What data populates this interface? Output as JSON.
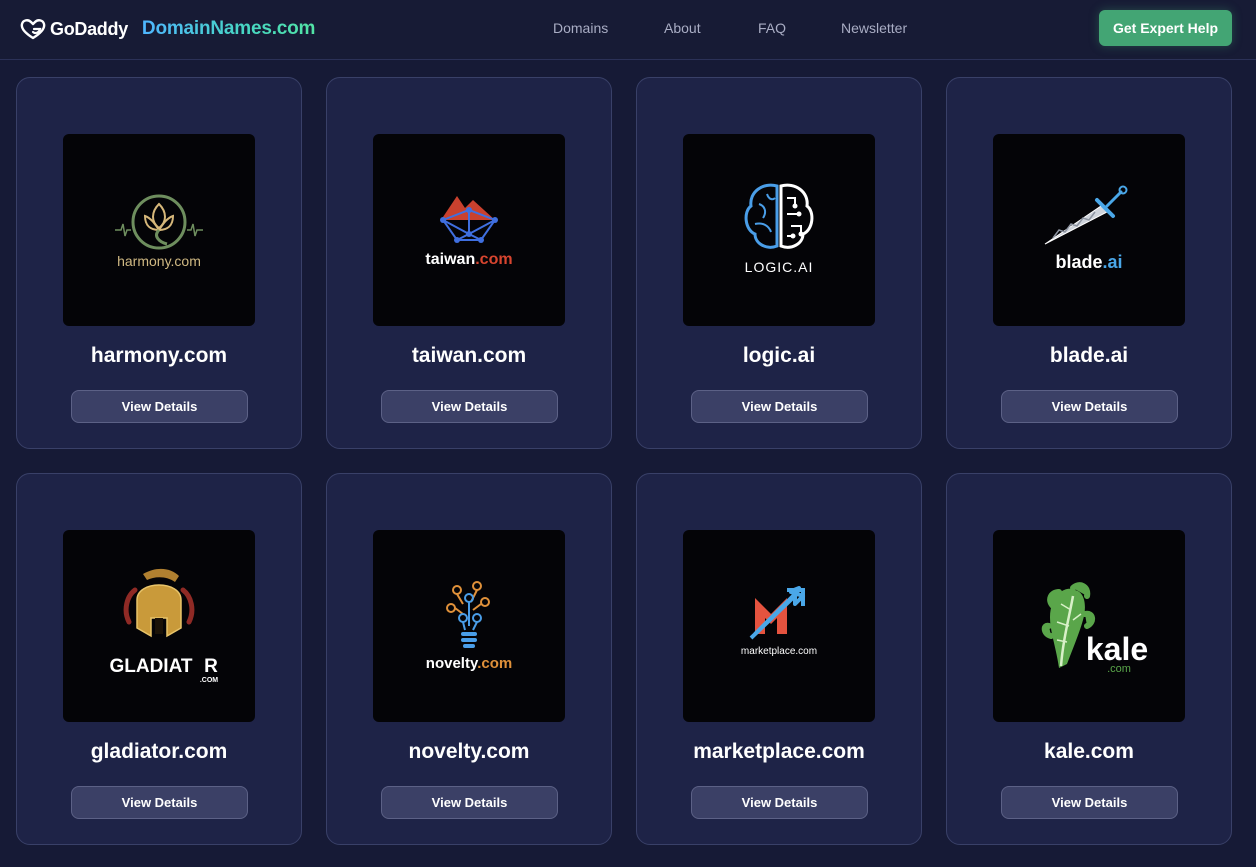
{
  "header": {
    "godaddy_label": "GoDaddy",
    "site_name": "DomainNames.com",
    "nav": [
      "Domains",
      "About",
      "FAQ",
      "Newsletter"
    ],
    "cta_label": "Get Expert Help"
  },
  "cards": [
    {
      "name": "harmony.com",
      "button": "View Details",
      "logo_text": "harmony.com",
      "logo_icon": "lotus-icon"
    },
    {
      "name": "taiwan.com",
      "button": "View Details",
      "logo_text_a": "taiwan",
      "logo_text_b": ".com",
      "logo_icon": "mountain-network-icon"
    },
    {
      "name": "logic.ai",
      "button": "View Details",
      "logo_text": "LOGIC.AI",
      "logo_icon": "brain-icon"
    },
    {
      "name": "blade.ai",
      "button": "View Details",
      "logo_text_a": "blade",
      "logo_text_b": ".ai",
      "logo_icon": "sword-icon"
    },
    {
      "name": "gladiator.com",
      "button": "View Details",
      "logo_text_a": "GLADIAT",
      "logo_text_b": "R",
      "logo_text_c": ".COM",
      "logo_icon": "helmet-icon"
    },
    {
      "name": "novelty.com",
      "button": "View Details",
      "logo_text_a": "novelty",
      "logo_text_b": ".com",
      "logo_icon": "lightbulb-icon"
    },
    {
      "name": "marketplace.com",
      "button": "View Details",
      "logo_text": "marketplace.com",
      "logo_icon": "m-arrow-icon"
    },
    {
      "name": "kale.com",
      "button": "View Details",
      "logo_text_a": "kale",
      "logo_text_b": ".com",
      "logo_icon": "kale-leaf-icon"
    }
  ],
  "colors": {
    "background": "#161a36",
    "card": "#1e2347",
    "cta": "#43a574",
    "brand_gradient_start": "#4fb6ff",
    "brand_gradient_end": "#52e3a5"
  }
}
